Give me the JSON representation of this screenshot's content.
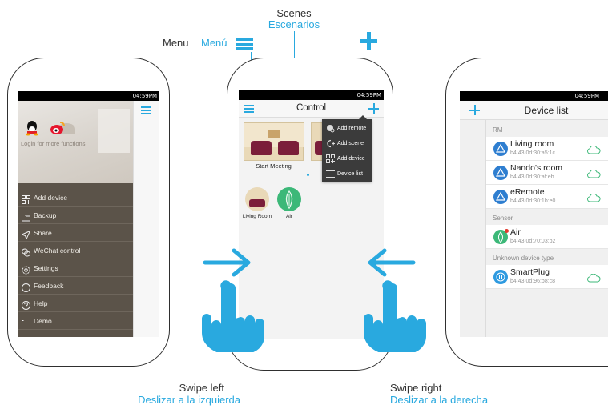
{
  "annotations": {
    "scenes_en": "Scenes",
    "scenes_es": "Escenarios",
    "menu_en": "Menu",
    "menu_es": "Menú",
    "swipe_left_en": "Swipe left",
    "swipe_left_es": "Deslizar a la izquierda",
    "swipe_right_en": "Swipe right",
    "swipe_right_es": "Deslizar a la derecha"
  },
  "status": {
    "time": "04:59PM"
  },
  "left_phone": {
    "login_text": "Login for more functions",
    "menu_items": [
      {
        "label": "Add device",
        "icon": "grid-plus-icon"
      },
      {
        "label": "Backup",
        "icon": "folder-icon"
      },
      {
        "label": "Share",
        "icon": "send-icon"
      },
      {
        "label": "WeChat control",
        "icon": "wechat-icon"
      },
      {
        "label": "Settings",
        "icon": "gear-icon"
      },
      {
        "label": "Feedback",
        "icon": "info-icon"
      },
      {
        "label": "Help",
        "icon": "help-icon"
      },
      {
        "label": "Demo",
        "icon": "demo-icon"
      }
    ]
  },
  "center_phone": {
    "title": "Control",
    "scene_label": "Start Meeting",
    "devices": [
      {
        "label": "Living Room"
      },
      {
        "label": "Air"
      }
    ],
    "dropdown": [
      {
        "label": "Add remote",
        "icon": "remote-icon"
      },
      {
        "label": "Add scene",
        "icon": "scene-icon"
      },
      {
        "label": "Add device",
        "icon": "grid-plus-icon"
      },
      {
        "label": "Device list",
        "icon": "list-icon"
      }
    ]
  },
  "right_phone": {
    "title": "Device list",
    "sections": [
      {
        "label": "RM",
        "devices": [
          {
            "name": "Living room",
            "mac": "b4:43:0d:30:a5:1c"
          },
          {
            "name": "Nando's room",
            "mac": "b4:43:0d:30:af:eb"
          },
          {
            "name": "eRemote",
            "mac": "b4:43:0d:30:1b:e0"
          }
        ]
      },
      {
        "label": "Sensor",
        "devices": [
          {
            "name": "Air",
            "mac": "b4:43:0d:70:03:b2"
          }
        ]
      },
      {
        "label": "Unknown device type",
        "devices": [
          {
            "name": "SmartPlug",
            "mac": "b4:43:0d:96:b8:c8"
          }
        ]
      }
    ]
  },
  "colors": {
    "accent": "#29a9df",
    "menu_bg": "#5b5349",
    "device_blue": "#2e7ed0",
    "device_green": "#3cb878"
  }
}
